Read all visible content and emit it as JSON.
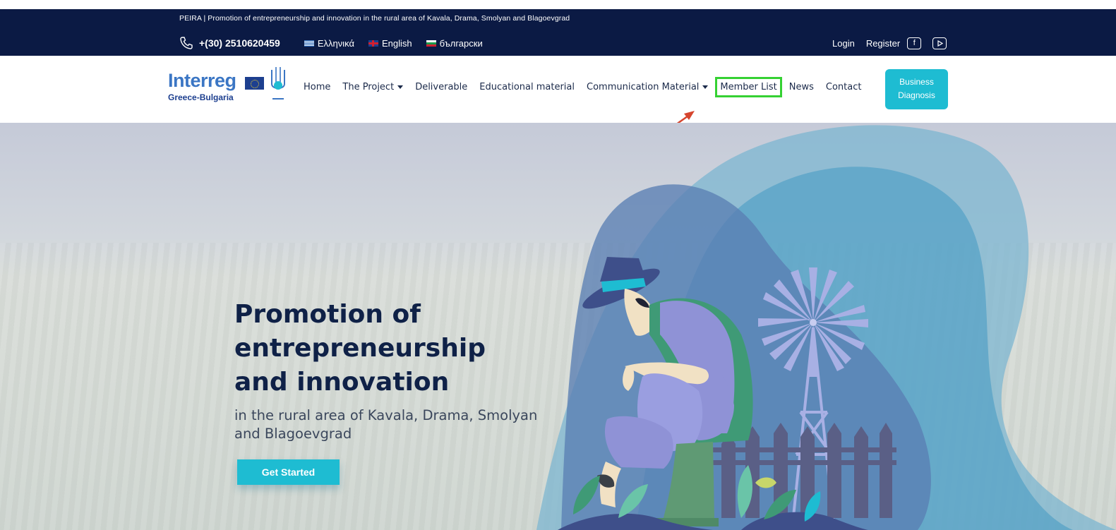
{
  "topbar": {
    "tagline": "PEIRA | Promotion of entrepreneurship and innovation in the rural area of Kavala, Drama, Smolyan and Blagoevgrad",
    "phone": "+(30) 2510620459",
    "languages": [
      {
        "label": "Ελληνικά",
        "flag": "greece-flag-icon"
      },
      {
        "label": "English",
        "flag": "uk-flag-icon"
      },
      {
        "label": "български",
        "flag": "bulgaria-flag-icon"
      }
    ],
    "login": "Login",
    "register": "Register",
    "social": [
      "facebook-icon",
      "youtube-icon"
    ],
    "background": "#0b1a44"
  },
  "header": {
    "logo": {
      "word": "Interreg",
      "sub": "Greece-Bulgaria"
    },
    "nav": {
      "home": "Home",
      "project": "The Project",
      "deliverable": "Deliverable",
      "educational": "Educational material",
      "communication": "Communication Material",
      "members": "Member List",
      "news": "News",
      "contact": "Contact"
    },
    "business_line1": "Business",
    "business_line2": "Diagnosis",
    "accent": "#1ebcd2",
    "highlight": "#35d133"
  },
  "hero": {
    "title": "Promotion of entrepreneurship and innovation",
    "subtitle": "in the rural area of Kavala, Drama, Smolyan and Blagoevgrad",
    "cta": "Get Started",
    "title_color": "#0f2147"
  }
}
